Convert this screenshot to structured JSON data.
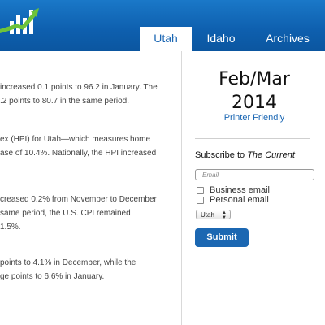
{
  "header": {
    "logo_icon": "rising-chart-logo-icon",
    "nav": {
      "utah": "Utah",
      "idaho": "Idaho",
      "archives": "Archives"
    }
  },
  "article": {
    "paragraphs": [
      {
        "lines": [
          "increased 0.1 points to 96.2 in January. The",
          ".2 points to 80.7 in the same period."
        ]
      },
      {
        "lines": [
          "ex (HPI) for Utah—which measures home",
          "ase of 10.4%. Nationally, the HPI increased"
        ]
      },
      {
        "lines": [
          "creased 0.2% from November to December",
          "same period, the U.S. CPI remained",
          "1.5%."
        ]
      },
      {
        "lines": [
          "points to 4.1% in December, while the",
          "ge points to 6.6% in January."
        ]
      }
    ]
  },
  "sidebar": {
    "issue_line1": "Feb/Mar",
    "issue_line2": "2014",
    "printer_friendly": "Printer Friendly",
    "subscribe_prefix": "Subscribe to ",
    "subscribe_title": "The Current",
    "email_placeholder": "Email",
    "options": {
      "business": "Business email",
      "personal": "Personal email"
    },
    "state_select": "Utah",
    "submit": "Submit"
  },
  "colors": {
    "header_blue": "#0e5fae",
    "link_blue": "#1a66b3",
    "button_blue": "#1b67b2"
  }
}
